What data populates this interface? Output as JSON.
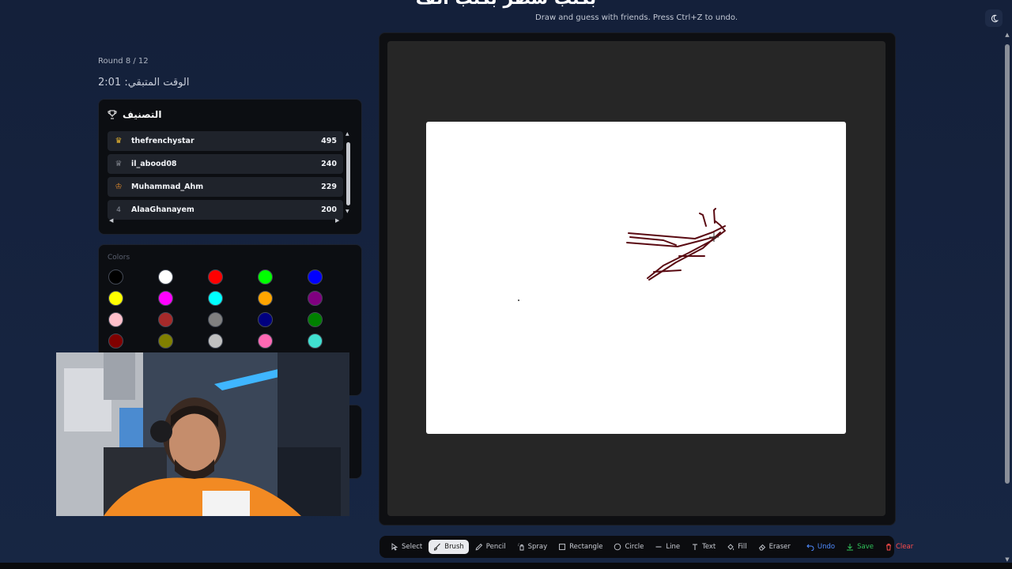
{
  "header": {
    "title": "بكتب سطر بكتب الف",
    "subtitle": "Draw and guess with friends. Press Ctrl+Z to undo."
  },
  "game": {
    "round": "Round 8 / 12",
    "time_remaining": "الوقت المتبقي: 2:01"
  },
  "leaderboard": {
    "title": "التصنيف",
    "rows": [
      {
        "rank_icon": "crown-icon",
        "rank": "",
        "name": "thefrenchystar",
        "score": "495",
        "icon_color": "#e5b32f"
      },
      {
        "rank_icon": "trophy-icon",
        "rank": "",
        "name": "il_abood08",
        "score": "240",
        "icon_color": "#b9bdc6"
      },
      {
        "rank_icon": "medal-icon",
        "rank": "",
        "name": "Muhammad_Ahm",
        "score": "229",
        "icon_color": "#e08a2c"
      },
      {
        "rank_icon": "",
        "rank": "4",
        "name": "AlaaGhanayem",
        "score": "200",
        "icon_color": ""
      }
    ]
  },
  "colors": {
    "label": "Colors",
    "swatches": [
      "#000000",
      "#ffffff",
      "#ff0000",
      "#00ff00",
      "#0000ff",
      "#ffff00",
      "#ff00ff",
      "#00ffff",
      "#ffa500",
      "#800080",
      "#ffc0cb",
      "#a52a2a",
      "#808080",
      "#000080",
      "#008000",
      "#800000",
      "#808000",
      "#c0c0c0",
      "#ff69b4",
      "#40e0d0"
    ]
  },
  "toolbar": {
    "tools": [
      {
        "id": "select",
        "label": "Select",
        "icon": "cursor-icon"
      },
      {
        "id": "brush",
        "label": "Brush",
        "icon": "brush-icon"
      },
      {
        "id": "pencil",
        "label": "Pencil",
        "icon": "pencil-icon"
      },
      {
        "id": "spray",
        "label": "Spray",
        "icon": "spray-icon"
      },
      {
        "id": "rectangle",
        "label": "Rectangle",
        "icon": "rectangle-icon"
      },
      {
        "id": "circle",
        "label": "Circle",
        "icon": "circle-icon"
      },
      {
        "id": "line",
        "label": "Line",
        "icon": "line-icon"
      },
      {
        "id": "text",
        "label": "Text",
        "icon": "text-icon"
      },
      {
        "id": "fill",
        "label": "Fill",
        "icon": "fill-icon"
      },
      {
        "id": "eraser",
        "label": "Eraser",
        "icon": "eraser-icon"
      }
    ],
    "active_tool": "brush",
    "undo_label": "Undo",
    "save_label": "Save",
    "clear_label": "Clear"
  },
  "canvas": {
    "stroke_color": "#5a0a12"
  }
}
